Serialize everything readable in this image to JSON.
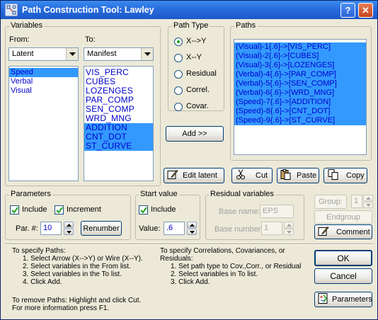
{
  "window": {
    "title": "Path Construction Tool: Lawley",
    "help_btn": "?",
    "close_btn": "✕"
  },
  "variables": {
    "group_label": "Variables",
    "from_label": "From:",
    "to_label": "To:",
    "from_select": "Latent",
    "to_select": "Manifest",
    "from_list": [
      {
        "label": "Speed",
        "selected": true
      },
      {
        "label": "Verbal",
        "selected": false
      },
      {
        "label": "Visual",
        "selected": false
      }
    ],
    "to_list": [
      {
        "label": "VIS_PERC",
        "selected": false
      },
      {
        "label": "CUBES",
        "selected": false
      },
      {
        "label": "LOZENGES",
        "selected": false
      },
      {
        "label": "PAR_COMP",
        "selected": false
      },
      {
        "label": "SEN_COMP",
        "selected": false
      },
      {
        "label": "WRD_MNG",
        "selected": false
      },
      {
        "label": "ADDITION",
        "selected": true
      },
      {
        "label": "CNT_DOT",
        "selected": true
      },
      {
        "label": "ST_CURVE",
        "selected": true
      }
    ]
  },
  "path_type": {
    "group_label": "Path Type",
    "options": [
      {
        "label": "X-->Y",
        "checked": true
      },
      {
        "label": "X--Y",
        "checked": false
      },
      {
        "label": "Residual",
        "checked": false
      },
      {
        "label": "Correl.",
        "checked": false
      },
      {
        "label": "Covar.",
        "checked": false
      }
    ],
    "add_button": "Add >>"
  },
  "paths": {
    "group_label": "Paths",
    "items": [
      "(Visual)-1{.6}->[VIS_PERC]",
      "(Visual)-2{.6}->[CUBES]",
      "(Visual)-3{.6}->[LOZENGES]",
      "(Verbal)-4{.6}->[PAR_COMP]",
      "(Verbal)-5{.6}->[SEN_COMP]",
      "(Verbal)-6{.6}->[WRD_MNG]",
      "(Speed)-7{.6}->[ADDITION]",
      "(Speed)-8{.6}->[CNT_DOT]",
      "(Speed)-9{.6}->[ST_CURVE]"
    ]
  },
  "toolbar": {
    "edit_latent": "Edit latent",
    "cut": "Cut",
    "paste": "Paste",
    "copy": "Copy"
  },
  "parameters": {
    "group_label": "Parameters",
    "include_label": "Include",
    "include_checked": true,
    "increment_label": "Increment",
    "increment_checked": true,
    "par_label": "Par. #:",
    "par_value": "10",
    "renumber": "Renumber"
  },
  "start_value": {
    "group_label": "Start value",
    "include_label": "Include",
    "include_checked": true,
    "value_label": "Value:",
    "value": ".6"
  },
  "residual": {
    "group_label": "Residual variables",
    "base_name_label": "Base name:",
    "base_name": "EPS",
    "base_number_label": "Base number:",
    "base_number": "1"
  },
  "right_panel": {
    "group_label": "Group:",
    "group_value": "1",
    "endgroup": "Endgroup",
    "comment": "Comment",
    "ok": "OK",
    "cancel": "Cancel",
    "parameters_btn": "Parameters"
  },
  "help": {
    "left": [
      {
        "text": "To specify Paths:",
        "indent": false
      },
      {
        "text": "1. Select Arrow (X-->Y) or Wire (X--Y).",
        "indent": true
      },
      {
        "text": "2. Select variables in the From list.",
        "indent": true
      },
      {
        "text": "3. Select variables in the To list.",
        "indent": true
      },
      {
        "text": "4. Click Add.",
        "indent": true
      }
    ],
    "right": [
      {
        "text": "To specify Correlations, Covariances, or",
        "indent": false
      },
      {
        "text": "Residuals:",
        "indent": false
      },
      {
        "text": "1. Set path type to Cov.,Corr., or Residual",
        "indent": true
      },
      {
        "text": "2. Select variables in To list.",
        "indent": true
      },
      {
        "text": "3. Click Add.",
        "indent": true
      }
    ],
    "remove_1": "To remove Paths: Highlight and click Cut.",
    "remove_2": "For more information press F1."
  },
  "colors": {
    "title_bar": "#2a6fe0",
    "selection": "#3399ff",
    "list_text": "#0000cc",
    "dialog_bg": "#ece9d8"
  }
}
